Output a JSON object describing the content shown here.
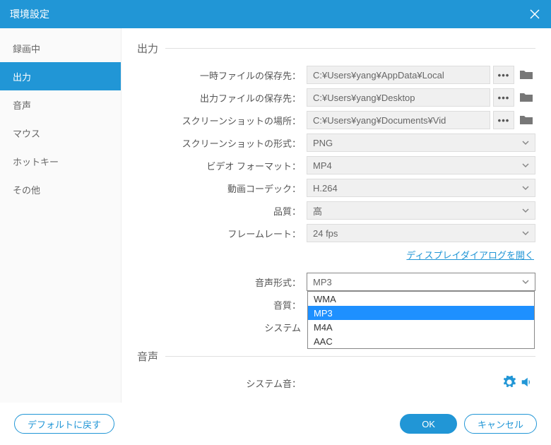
{
  "titlebar": {
    "title": "環境設定"
  },
  "sidebar": {
    "items": [
      {
        "label": "録画中"
      },
      {
        "label": "出力"
      },
      {
        "label": "音声"
      },
      {
        "label": "マウス"
      },
      {
        "label": "ホットキー"
      },
      {
        "label": "その他"
      }
    ],
    "active_index": 1
  },
  "sections": {
    "output": {
      "heading": "出力"
    },
    "audio": {
      "heading": "音声"
    }
  },
  "rows": {
    "temp_path": {
      "label": "一時ファイルの保存先：",
      "value": "C:¥Users¥yang¥AppData¥Local"
    },
    "output_path": {
      "label": "出力ファイルの保存先：",
      "value": "C:¥Users¥yang¥Desktop"
    },
    "screenshot_path": {
      "label": "スクリーンショットの場所：",
      "value": "C:¥Users¥yang¥Documents¥Vid"
    },
    "screenshot_fmt": {
      "label": "スクリーンショットの形式：",
      "value": "PNG"
    },
    "video_fmt": {
      "label": "ビデオ フォーマット：",
      "value": "MP4"
    },
    "video_codec": {
      "label": "動画コーデック：",
      "value": "H.264"
    },
    "quality": {
      "label": "品質：",
      "value": "高"
    },
    "framerate": {
      "label": "フレームレート：",
      "value": "24 fps"
    },
    "audio_fmt": {
      "label": "音声形式：",
      "value": "MP3"
    },
    "audio_quality": {
      "label": "音質："
    },
    "system": {
      "label": "システム"
    },
    "system_sound": {
      "label": "システム音："
    }
  },
  "audio_fmt_options": [
    "WMA",
    "MP3",
    "M4A",
    "AAC"
  ],
  "audio_fmt_selected_index": 1,
  "links": {
    "display_dialog": "ディスプレイダイアログを開く"
  },
  "buttons": {
    "browse": "•••",
    "reset": "デフォルトに戻す",
    "ok": "OK",
    "cancel": "キャンセル"
  }
}
